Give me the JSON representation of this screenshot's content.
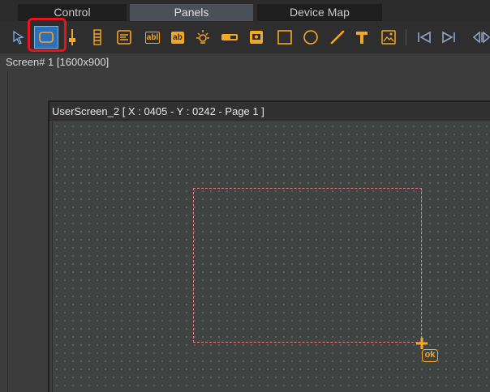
{
  "tabs": [
    {
      "label": "Control",
      "active": false
    },
    {
      "label": "Panels",
      "active": true
    },
    {
      "label": "Device Map",
      "active": false
    }
  ],
  "toolbar": {
    "accent": "#f5a623",
    "selected_tool": "panel-rectangle-tool",
    "highlight_color": "#e8141c",
    "text_field_label": "abl",
    "text_label_label": "ab"
  },
  "screen": {
    "label": "Screen# 1 [1600x900]"
  },
  "window": {
    "title": "UserScreen_2 [ X : 0405 - Y : 0242 - Page 1 ]"
  },
  "cursor": {
    "badge": "ok"
  }
}
